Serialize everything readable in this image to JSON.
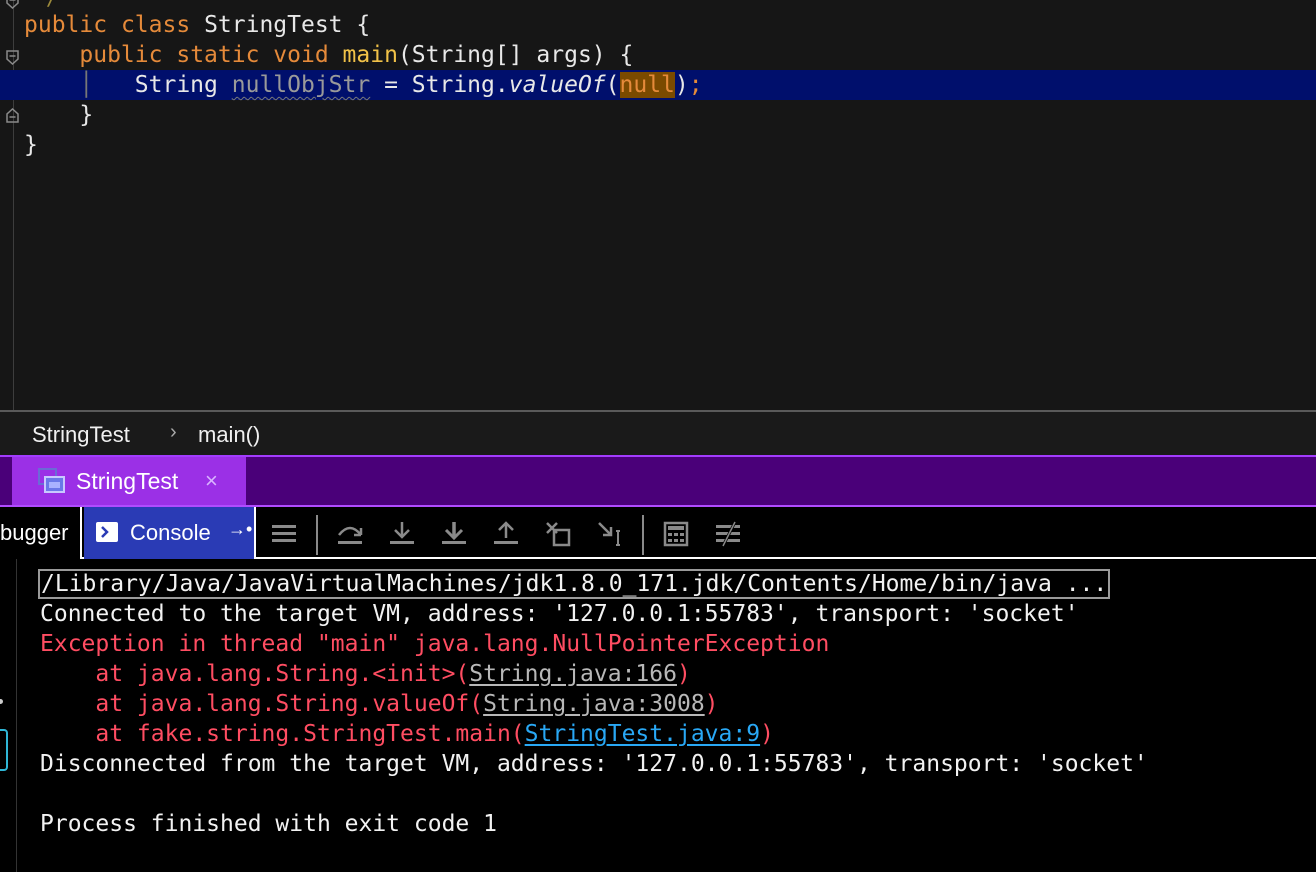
{
  "editor": {
    "lines": [
      {
        "kw1": "public",
        "kw2": "class",
        "name": "StringTest",
        "brace": "{"
      },
      {
        "kw1": "public",
        "kw2": "static",
        "kw3": "void",
        "fn": "main",
        "params": "(String[] args) {"
      },
      {
        "type": "String",
        "var": "nullObjStr",
        "eq": " = String.",
        "method": "valueOf",
        "open": "(",
        "arg": "null",
        "close": ")",
        "semi": ";"
      },
      {
        "text": "}"
      },
      {
        "text": "}"
      }
    ],
    "comment_tail": "*/"
  },
  "breadcrumb": {
    "class_name": "StringTest",
    "separator": "›",
    "method_name": "main()"
  },
  "run_tab": {
    "label": "StringTest",
    "close": "×"
  },
  "toolbar": {
    "debugger_label": "bugger",
    "console_label": "Console",
    "console_pin": "→•",
    "icons": [
      "menu-icon",
      "step-over-icon",
      "step-into-icon",
      "force-step-into-icon",
      "step-out-icon",
      "drop-frame-icon",
      "run-to-cursor-icon",
      "evaluate-expression-icon",
      "trace-icon"
    ]
  },
  "console": {
    "command": "/Library/Java/JavaVirtualMachines/jdk1.8.0_171.jdk/Contents/Home/bin/java ...",
    "connected": "Connected to the target VM, address: '127.0.0.1:55783', transport: 'socket'",
    "exception": "Exception in thread \"main\" java.lang.NullPointerException",
    "stack": [
      {
        "prefix": "    at java.lang.String.<init>(",
        "link": "String.java:166",
        "suffix": ")"
      },
      {
        "prefix": "    at java.lang.String.valueOf(",
        "link": "String.java:3008",
        "suffix": ")"
      },
      {
        "prefix": "    at fake.string.StringTest.main(",
        "link": "StringTest.java:9",
        "suffix": ")"
      }
    ],
    "disconnected": "Disconnected from the target VM, address: '127.0.0.1:55783', transport: 'socket'",
    "finished": "Process finished with exit code 1"
  },
  "colors": {
    "keyword": "#e58a3a",
    "function": "#f1c248",
    "error": "#ff4d62",
    "link": "#29a8f5",
    "line_highlight": "#000f6c",
    "run_tab_bar": "#4a0079",
    "run_tab_active": "#9b30e6",
    "console_tab_active": "#2a3bb5"
  }
}
